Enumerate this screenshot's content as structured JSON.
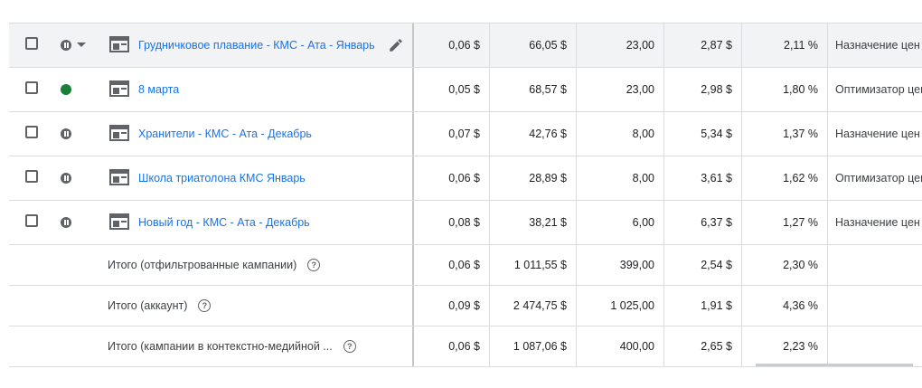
{
  "campaigns": [
    {
      "name": "Грудничковое плавание - КМС - Ата - Январь",
      "status": "paused",
      "c1": "0,06 $",
      "c2": "66,05 $",
      "c3": "23,00",
      "c4": "2,87 $",
      "c5": "2,11 %",
      "c6": "Назначение цен"
    },
    {
      "name": "8 марта",
      "status": "active",
      "c1": "0,05 $",
      "c2": "68,57 $",
      "c3": "23,00",
      "c4": "2,98 $",
      "c5": "1,80 %",
      "c6": "Оптимизатор цен"
    },
    {
      "name": "Хранители - КМС - Ата - Декабрь",
      "status": "paused",
      "c1": "0,07 $",
      "c2": "42,76 $",
      "c3": "8,00",
      "c4": "5,34 $",
      "c5": "1,37 %",
      "c6": "Назначение цен"
    },
    {
      "name": "Школа триатолона КМС Январь",
      "status": "paused",
      "c1": "0,06 $",
      "c2": "28,89 $",
      "c3": "8,00",
      "c4": "3,61 $",
      "c5": "1,62 %",
      "c6": "Оптимизатор цен"
    },
    {
      "name": "Новый год - КМС - Ата - Декабрь",
      "status": "paused",
      "c1": "0,08 $",
      "c2": "38,21 $",
      "c3": "6,00",
      "c4": "6,37 $",
      "c5": "1,27 %",
      "c6": "Назначение цен"
    }
  ],
  "totals": [
    {
      "label": "Итого (отфильтрованные кампании)",
      "c1": "0,06 $",
      "c2": "1 011,55 $",
      "c3": "399,00",
      "c4": "2,54 $",
      "c5": "2,30 %"
    },
    {
      "label": "Итого (аккаунт)",
      "c1": "0,09 $",
      "c2": "2 474,75 $",
      "c3": "1 025,00",
      "c4": "1,91 $",
      "c5": "4,36 %"
    },
    {
      "label": "Итого (кампании в контекстно-медийной ...",
      "c1": "0,06 $",
      "c2": "1 087,06 $",
      "c3": "400,00",
      "c4": "2,65 $",
      "c5": "2,23 %"
    }
  ],
  "help_glyph": "?",
  "colors": {
    "link": "#1a73e8",
    "active": "#188038",
    "paused": "#5f6368"
  }
}
